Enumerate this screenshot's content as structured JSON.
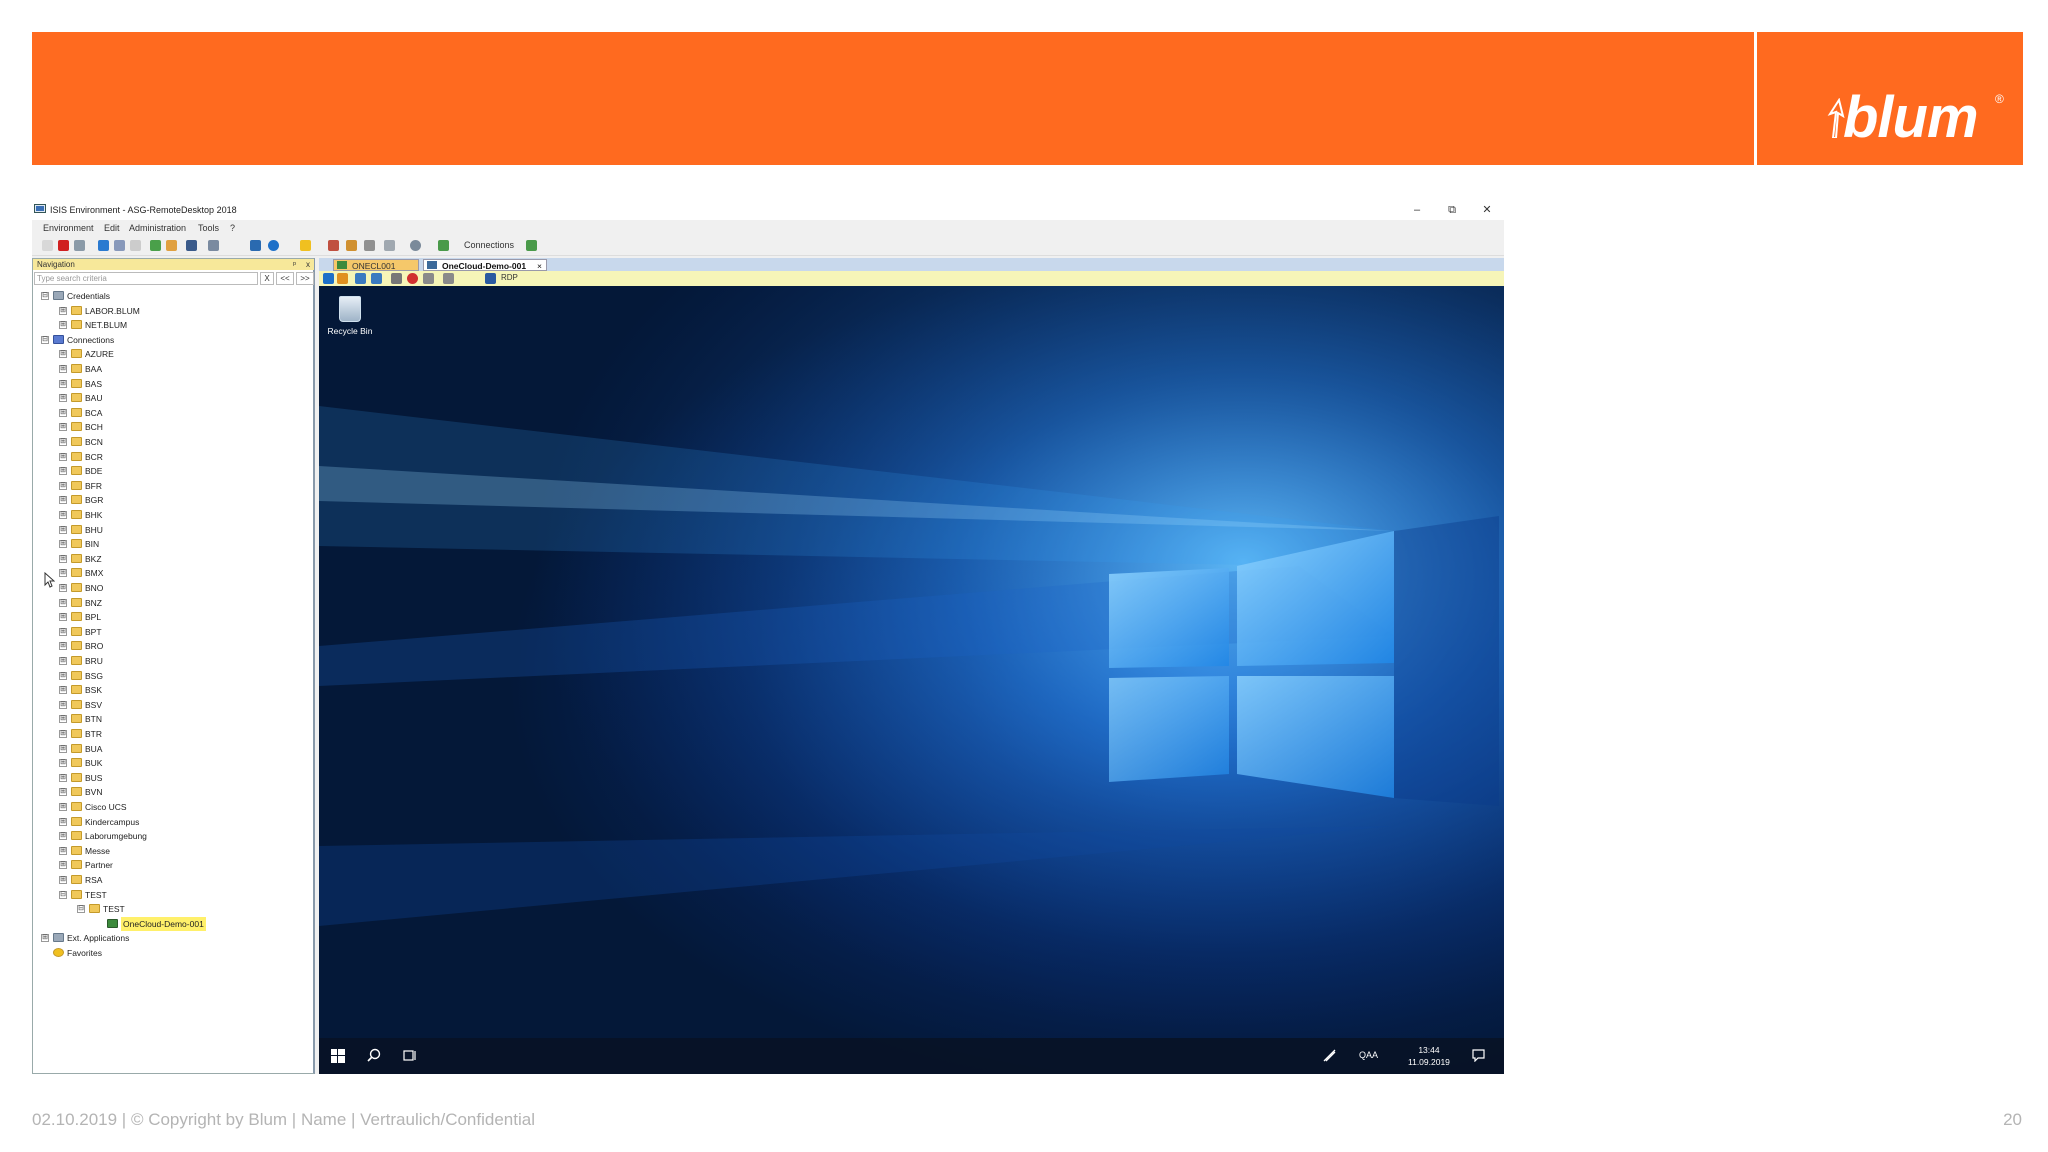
{
  "slide": {
    "brand": "blum",
    "brand_mark": "®",
    "footer": "02.10.2019  |  © Copyright by Blum  |  Name  |  Vertraulich/Confidential",
    "page_number": "20",
    "banner_color": "#ff6a1f"
  },
  "window": {
    "title": "ISIS Environment - ASG-RemoteDesktop 2018",
    "minimize": "–",
    "restore": "⧉",
    "close": "✕"
  },
  "menu": [
    "Environment",
    "Edit",
    "Administration",
    "Tools",
    "?"
  ],
  "toolbar": {
    "connections_label": "Connections"
  },
  "navigation": {
    "header": "Navigation",
    "pin": "ᵖ",
    "close": "x",
    "search_placeholder": "Type search criteria",
    "clear": "X",
    "prev": "<<",
    "next": ">>",
    "tree": [
      {
        "label": "Credentials",
        "level": 0,
        "expander": "⊟",
        "icon": "credentials-icon"
      },
      {
        "label": "LABOR.BLUM",
        "level": 1,
        "expander": "⊞",
        "icon": "folder-icon"
      },
      {
        "label": "NET.BLUM",
        "level": 1,
        "expander": "⊞",
        "icon": "folder-icon"
      },
      {
        "label": "Connections",
        "level": 0,
        "expander": "⊟",
        "icon": "connections-icon"
      },
      {
        "label": "AZURE",
        "level": 1,
        "expander": "⊞",
        "icon": "folder-icon"
      },
      {
        "label": "BAA",
        "level": 1,
        "expander": "⊞",
        "icon": "folder-icon"
      },
      {
        "label": "BAS",
        "level": 1,
        "expander": "⊞",
        "icon": "folder-icon"
      },
      {
        "label": "BAU",
        "level": 1,
        "expander": "⊞",
        "icon": "folder-icon"
      },
      {
        "label": "BCA",
        "level": 1,
        "expander": "⊞",
        "icon": "folder-icon"
      },
      {
        "label": "BCH",
        "level": 1,
        "expander": "⊞",
        "icon": "folder-icon"
      },
      {
        "label": "BCN",
        "level": 1,
        "expander": "⊞",
        "icon": "folder-icon"
      },
      {
        "label": "BCR",
        "level": 1,
        "expander": "⊞",
        "icon": "folder-icon"
      },
      {
        "label": "BDE",
        "level": 1,
        "expander": "⊞",
        "icon": "folder-icon"
      },
      {
        "label": "BFR",
        "level": 1,
        "expander": "⊞",
        "icon": "folder-icon"
      },
      {
        "label": "BGR",
        "level": 1,
        "expander": "⊞",
        "icon": "folder-icon"
      },
      {
        "label": "BHK",
        "level": 1,
        "expander": "⊞",
        "icon": "folder-icon"
      },
      {
        "label": "BHU",
        "level": 1,
        "expander": "⊞",
        "icon": "folder-icon"
      },
      {
        "label": "BIN",
        "level": 1,
        "expander": "⊞",
        "icon": "folder-icon"
      },
      {
        "label": "BKZ",
        "level": 1,
        "expander": "⊞",
        "icon": "folder-icon"
      },
      {
        "label": "BMX",
        "level": 1,
        "expander": "⊞",
        "icon": "folder-icon"
      },
      {
        "label": "BNO",
        "level": 1,
        "expander": "⊞",
        "icon": "folder-icon"
      },
      {
        "label": "BNZ",
        "level": 1,
        "expander": "⊞",
        "icon": "folder-icon"
      },
      {
        "label": "BPL",
        "level": 1,
        "expander": "⊞",
        "icon": "folder-icon"
      },
      {
        "label": "BPT",
        "level": 1,
        "expander": "⊞",
        "icon": "folder-icon"
      },
      {
        "label": "BRO",
        "level": 1,
        "expander": "⊞",
        "icon": "folder-icon"
      },
      {
        "label": "BRU",
        "level": 1,
        "expander": "⊞",
        "icon": "folder-icon"
      },
      {
        "label": "BSG",
        "level": 1,
        "expander": "⊞",
        "icon": "folder-icon"
      },
      {
        "label": "BSK",
        "level": 1,
        "expander": "⊞",
        "icon": "folder-icon"
      },
      {
        "label": "BSV",
        "level": 1,
        "expander": "⊞",
        "icon": "folder-icon"
      },
      {
        "label": "BTN",
        "level": 1,
        "expander": "⊞",
        "icon": "folder-icon"
      },
      {
        "label": "BTR",
        "level": 1,
        "expander": "⊞",
        "icon": "folder-icon"
      },
      {
        "label": "BUA",
        "level": 1,
        "expander": "⊞",
        "icon": "folder-icon"
      },
      {
        "label": "BUK",
        "level": 1,
        "expander": "⊞",
        "icon": "folder-icon"
      },
      {
        "label": "BUS",
        "level": 1,
        "expander": "⊞",
        "icon": "folder-icon"
      },
      {
        "label": "BVN",
        "level": 1,
        "expander": "⊞",
        "icon": "folder-icon"
      },
      {
        "label": "Cisco UCS",
        "level": 1,
        "expander": "⊞",
        "icon": "folder-icon"
      },
      {
        "label": "Kindercampus",
        "level": 1,
        "expander": "⊞",
        "icon": "folder-icon"
      },
      {
        "label": "Laborumgebung",
        "level": 1,
        "expander": "⊞",
        "icon": "folder-icon"
      },
      {
        "label": "Messe",
        "level": 1,
        "expander": "⊞",
        "icon": "folder-icon"
      },
      {
        "label": "Partner",
        "level": 1,
        "expander": "⊞",
        "icon": "folder-icon"
      },
      {
        "label": "RSA",
        "level": 1,
        "expander": "⊞",
        "icon": "folder-icon"
      },
      {
        "label": "TEST",
        "level": 1,
        "expander": "⊟",
        "icon": "folder-icon"
      },
      {
        "label": "TEST",
        "level": 2,
        "expander": "⊟",
        "icon": "folder-icon"
      },
      {
        "label": "OneCloud-Demo-001",
        "level": 3,
        "expander": "",
        "icon": "rdp-connection-icon",
        "selected": true
      },
      {
        "label": "Ext. Applications",
        "level": 0,
        "expander": "⊞",
        "icon": "applications-icon"
      },
      {
        "label": "Favorites",
        "level": 0,
        "expander": "",
        "icon": "star-icon"
      }
    ]
  },
  "tabs": [
    {
      "label": "ONECL001",
      "active": false
    },
    {
      "label": "OneCloud-Demo-001",
      "active": true,
      "close": "×"
    }
  ],
  "session_toolbar": {
    "rdp_label": "RDP"
  },
  "remote_desktop": {
    "recycle_bin_label": "Recycle Bin",
    "language": "QAA",
    "time": "13:44",
    "date": "11.09.2019"
  }
}
